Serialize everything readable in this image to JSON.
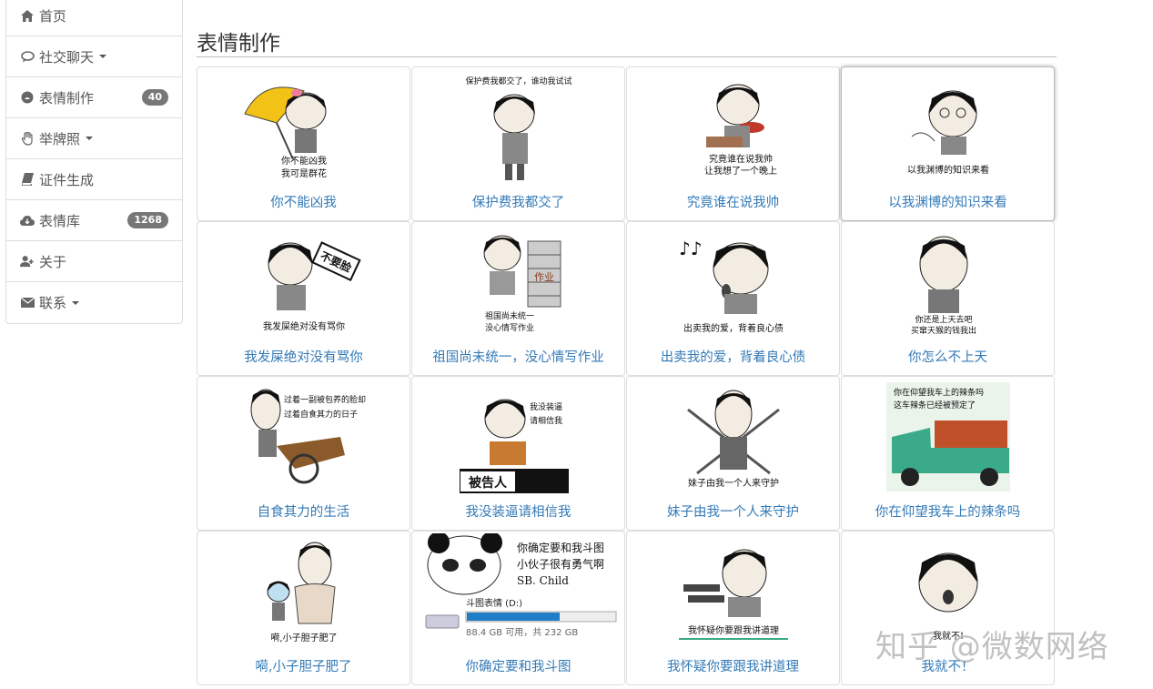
{
  "sidebar": {
    "items": [
      {
        "label": "首页",
        "icon": "home-icon"
      },
      {
        "label": "社交聊天",
        "icon": "chat-bubble-icon",
        "dropdown": true
      },
      {
        "label": "表情制作",
        "icon": "emoji-icon",
        "badge": "40"
      },
      {
        "label": "举牌照",
        "icon": "hand-icon",
        "dropdown": true
      },
      {
        "label": "证件生成",
        "icon": "book-icon"
      },
      {
        "label": "表情库",
        "icon": "cloud-download-icon",
        "badge": "1268"
      },
      {
        "label": "关于",
        "icon": "user-add-icon"
      },
      {
        "label": "联系",
        "icon": "envelope-icon",
        "dropdown": true
      }
    ]
  },
  "main": {
    "title": "表情制作",
    "cards": [
      {
        "caption": "你不能凶我",
        "meme_text": [
          "你不能凶我",
          "我可是群花"
        ]
      },
      {
        "caption": "保护费我都交了",
        "meme_text": [
          "保护费我都交了，谁动我试试"
        ]
      },
      {
        "caption": "究竟谁在说我帅",
        "meme_text": [
          "究竟谁在说我帅",
          "让我想了一个晚上"
        ]
      },
      {
        "caption": "以我渊博的知识来看",
        "meme_text": [
          "以我渊博的知识来看"
        ]
      },
      {
        "caption": "我发屎绝对没有骂你",
        "meme_text": [
          "不要脸",
          "我发屎绝对没有骂你"
        ]
      },
      {
        "caption": "祖国尚未统一，没心情写作业",
        "meme_text": [
          "作业",
          "祖国尚未统一",
          "没心情写作业"
        ]
      },
      {
        "caption": "出卖我的爱，背着良心债",
        "meme_text": [
          "出卖我的爱，背着良心债"
        ]
      },
      {
        "caption": "你怎么不上天",
        "meme_text": [
          "你还是上天去吧",
          "买窜天猴的钱我出"
        ]
      },
      {
        "caption": "自食其力的生活",
        "meme_text": [
          "过着一副被包养的脸却",
          "过着自食其力的日子"
        ]
      },
      {
        "caption": "我没装逼请相信我",
        "meme_text": [
          "我没装逼",
          "请相信我",
          "被告人"
        ]
      },
      {
        "caption": "妹子由我一个人来守护",
        "meme_text": [
          "妹子由我一个人来守护"
        ]
      },
      {
        "caption": "你在仰望我车上的辣条吗",
        "meme_text": [
          "你在仰望我车上的辣条吗",
          "这车辣条已经被预定了"
        ]
      },
      {
        "caption": "嗬,小子胆子肥了",
        "meme_text": [
          "嗬,小子胆子肥了"
        ]
      },
      {
        "caption": "你确定要和我斗图",
        "meme_text": [
          "你确定要和我斗图",
          "小伙子很有勇气啊",
          "SB. Child",
          "斗图表情 (D:)",
          "88.4 GB 可用，共 232 GB"
        ]
      },
      {
        "caption": "我怀疑你要跟我讲道理",
        "meme_text": [
          "我怀疑你要跟我讲道理"
        ]
      },
      {
        "caption": "我就不！",
        "meme_text": [
          "我就不!"
        ]
      }
    ]
  },
  "watermark": "知乎 @微数网络",
  "colors": {
    "link": "#337ab7",
    "badge": "#777777",
    "border": "#dddddd",
    "truck": "#3aaa8a"
  }
}
